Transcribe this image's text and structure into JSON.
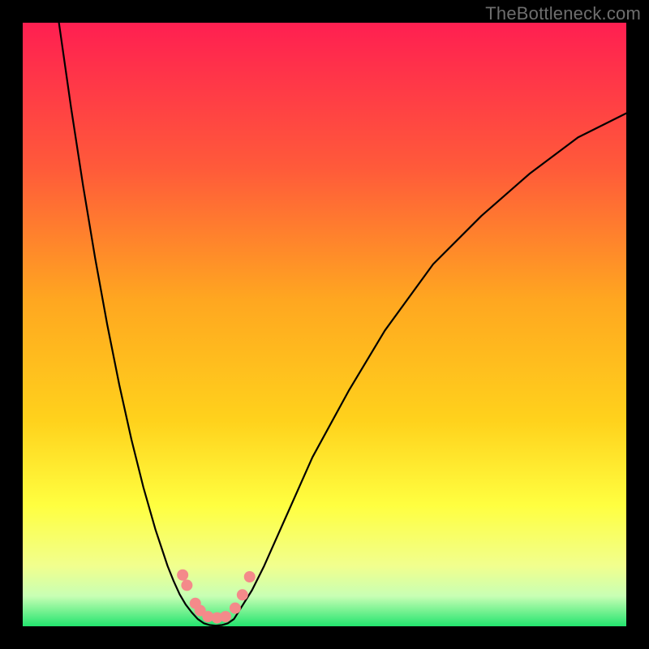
{
  "watermark": "TheBottleneck.com",
  "colors": {
    "outer_border": "#000000",
    "gradient_top": "#ff1f51",
    "gradient_mid1": "#ff7a2e",
    "gradient_mid2": "#ffd21c",
    "gradient_mid3": "#ffff40",
    "gradient_mid4": "#f1ff8e",
    "gradient_bottom": "#23e46e",
    "curve": "#000000",
    "dot": "#f48a8a"
  },
  "chart_data": {
    "type": "line",
    "title": "",
    "xlabel": "",
    "ylabel": "",
    "xlim": [
      0,
      100
    ],
    "ylim": [
      0,
      100
    ],
    "grid": false,
    "legend": false,
    "note": "Values are approximate, read visually from an unlabeled bottleneck curve. x is horizontal fraction (0–100 left→right), y is curve height fraction (0–100 bottom→top).",
    "series": [
      {
        "name": "left-branch",
        "x": [
          6,
          8,
          10,
          12,
          14,
          16,
          18,
          20,
          22,
          23,
          24,
          25,
          26,
          27,
          28,
          29
        ],
        "values": [
          100,
          86,
          73,
          61,
          50,
          40,
          31,
          23,
          16,
          13,
          10,
          7.5,
          5.3,
          3.6,
          2.3,
          1.2
        ]
      },
      {
        "name": "valley-floor",
        "x": [
          29,
          30,
          31,
          32,
          33,
          34,
          35
        ],
        "values": [
          1.2,
          0.5,
          0.2,
          0.1,
          0.2,
          0.5,
          1.2
        ]
      },
      {
        "name": "right-branch",
        "x": [
          35,
          36,
          38,
          40,
          44,
          48,
          54,
          60,
          68,
          76,
          84,
          92,
          100
        ],
        "values": [
          1.2,
          2.8,
          6,
          10,
          19,
          28,
          39,
          49,
          60,
          68,
          75,
          81,
          85
        ]
      }
    ],
    "markers": [
      {
        "name": "dot-left-upper-a",
        "x": 26.5,
        "y": 8.5
      },
      {
        "name": "dot-left-upper-b",
        "x": 27.2,
        "y": 6.8
      },
      {
        "name": "dot-left-lower-a",
        "x": 28.6,
        "y": 3.8
      },
      {
        "name": "dot-left-lower-b",
        "x": 29.4,
        "y": 2.6
      },
      {
        "name": "dot-floor-a",
        "x": 30.7,
        "y": 1.6
      },
      {
        "name": "dot-floor-b",
        "x": 32.2,
        "y": 1.4
      },
      {
        "name": "dot-floor-c",
        "x": 33.6,
        "y": 1.6
      },
      {
        "name": "dot-right-lower",
        "x": 35.2,
        "y": 3.0
      },
      {
        "name": "dot-right-mid",
        "x": 36.4,
        "y": 5.2
      },
      {
        "name": "dot-right-upper",
        "x": 37.6,
        "y": 8.2
      }
    ]
  }
}
